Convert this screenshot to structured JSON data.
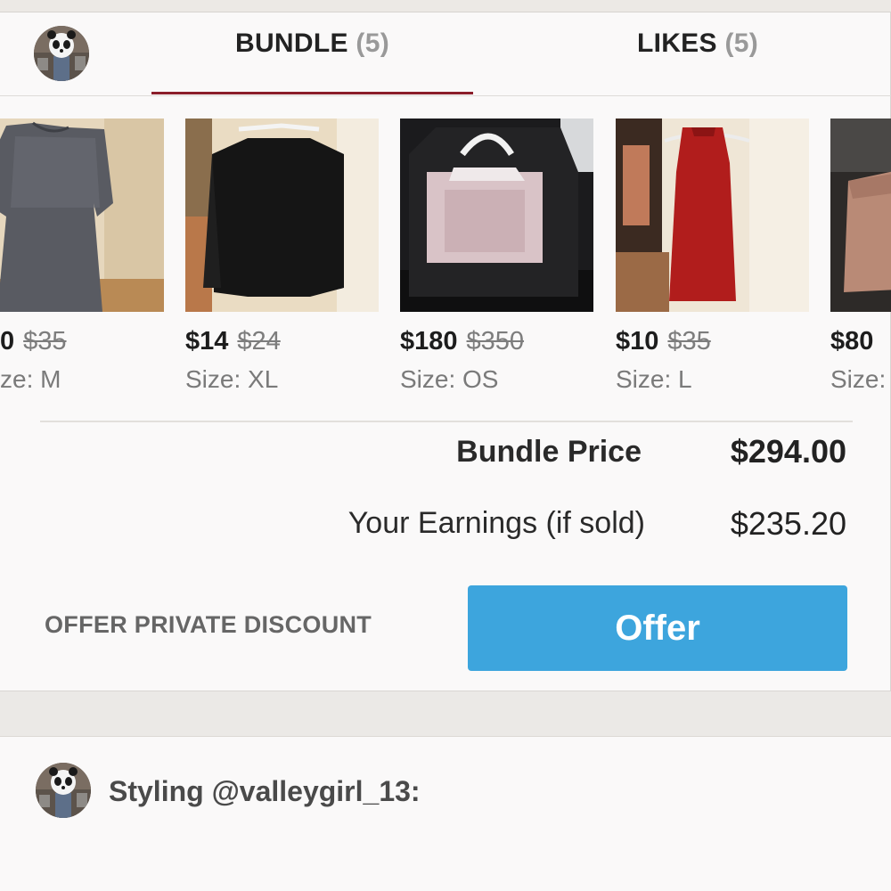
{
  "tabs": [
    {
      "label": "BUNDLE",
      "count": "(5)",
      "active": true
    },
    {
      "label": "LIKES",
      "count": "(5)",
      "active": false
    }
  ],
  "accent_color": "#8b1e2a",
  "products": [
    {
      "price": "0",
      "original_price": "$35",
      "size": "ze: M",
      "image": "gray-knit-dress"
    },
    {
      "price": "$14",
      "original_price": "$24",
      "size": "Size: XL",
      "image": "black-top"
    },
    {
      "price": "$180",
      "original_price": "$350",
      "size": "Size: OS",
      "image": "pink-tote-bag"
    },
    {
      "price": "$10",
      "original_price": "$35",
      "size": "Size: L",
      "image": "red-dress"
    },
    {
      "price": "$80",
      "original_price": "",
      "size": "Size:",
      "image": "tan-clutch"
    }
  ],
  "summary": {
    "bundle_price_label": "Bundle Price",
    "bundle_price_value": "$294.00",
    "earnings_label": "Your Earnings (if sold)",
    "earnings_value": "$235.20"
  },
  "actions": {
    "private_discount_label": "OFFER PRIVATE DISCOUNT",
    "offer_label": "Offer",
    "offer_color": "#3da5dd"
  },
  "comment": {
    "text": "Styling @valleygirl_13:"
  }
}
